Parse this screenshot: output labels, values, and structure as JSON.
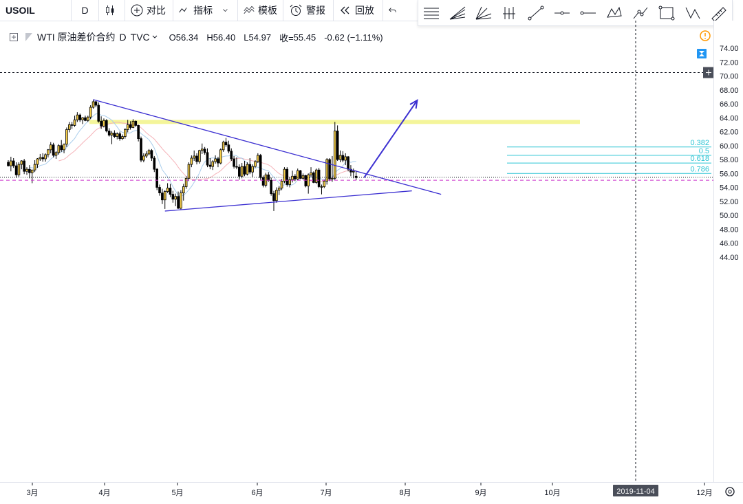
{
  "toolbar": {
    "symbol": "USOIL",
    "interval": "D",
    "compare_label": "对比",
    "indicators_label": "指标",
    "templates_label": "模板",
    "alert_label": "警报",
    "replay_label": "回放"
  },
  "legend": {
    "title": "WTI 原油差价合约",
    "interval": "D",
    "exchange": "TVC",
    "open_label": "O",
    "open": "56.34",
    "high_label": "H",
    "high": "56.40",
    "low_label": "L",
    "low": "54.97",
    "close_label": "收=",
    "close": "55.45",
    "change": "-0.62 (−1.11%)"
  },
  "drawing_tools": [
    "horizontal-lines-icon",
    "fan-lines-icon",
    "gann-fan-icon",
    "pitchfork-icon",
    "trend-line-icon",
    "horizontal-line-icon",
    "horizontal-ray-icon",
    "xabcd-pattern-icon",
    "path-icon",
    "rectangle-icon",
    "abcd-pattern-icon",
    "ruler-icon"
  ],
  "colors": {
    "up_fill": "#f7cf48",
    "down_fill": "#000000",
    "trendline": "#3b2fd1",
    "arrow": "#3b2fd1",
    "fib": "#2ac4d4",
    "support_band": "#f4f59a",
    "ma_slow": "#f5b2b8",
    "ma_fast": "#a9cdec",
    "price_badge": "#131722",
    "magenta_line": "#cc33cc",
    "crosshair_badge": "#4a4e59"
  },
  "chart_data": {
    "type": "candlestick",
    "symbol": "USOIL",
    "interval": "D",
    "y_axis": {
      "range": [
        42.5,
        75.5
      ],
      "ticks": [
        "74.00",
        "72.00",
        "70.00",
        "68.00",
        "66.00",
        "64.00",
        "62.00",
        "60.00",
        "58.00",
        "56.00",
        "54.00",
        "52.00",
        "50.00",
        "48.00",
        "46.00",
        "44.00"
      ]
    },
    "x_axis": {
      "ticks": [
        "3月",
        "4月",
        "5月",
        "6月",
        "7月",
        "8月",
        "9月",
        "10月",
        "12月"
      ],
      "crosshair_label": "2019-11-04"
    },
    "last_price": "55.45",
    "crosshair_price": "70.49",
    "magenta_price": "55.03",
    "support_band_level": 63.4,
    "fibonacci": [
      {
        "ratio": "0.382",
        "price": 59.8
      },
      {
        "ratio": "0.5",
        "price": 58.6
      },
      {
        "ratio": "0.618",
        "price": 57.5
      },
      {
        "ratio": "0.786",
        "price": 56.0
      }
    ],
    "candles": [
      [
        57.6,
        57.9,
        57.0,
        57.1
      ],
      [
        57.1,
        58.4,
        56.3,
        57.8
      ],
      [
        57.8,
        58.2,
        56.8,
        57.1
      ],
      [
        57.1,
        57.6,
        55.4,
        55.8
      ],
      [
        55.8,
        57.6,
        55.5,
        57.3
      ],
      [
        57.3,
        57.9,
        56.6,
        57.8
      ],
      [
        57.8,
        58.1,
        55.9,
        56.3
      ],
      [
        56.3,
        56.9,
        55.8,
        56.6
      ],
      [
        56.6,
        57.2,
        55.3,
        56.1
      ],
      [
        56.1,
        56.5,
        54.6,
        56.5
      ],
      [
        56.5,
        57.9,
        56.2,
        57.3
      ],
      [
        57.3,
        58.2,
        56.8,
        58.1
      ],
      [
        58.1,
        58.8,
        57.8,
        58.3
      ],
      [
        58.3,
        58.9,
        57.7,
        58.1
      ],
      [
        58.1,
        58.9,
        57.7,
        58.7
      ],
      [
        58.7,
        59.5,
        58.3,
        59.4
      ],
      [
        59.4,
        60.5,
        58.9,
        60.1
      ],
      [
        60.1,
        60.4,
        58.3,
        58.6
      ],
      [
        58.6,
        59.2,
        58.1,
        59.0
      ],
      [
        59.0,
        60.2,
        58.7,
        60.0
      ],
      [
        60.0,
        60.8,
        59.1,
        59.4
      ],
      [
        59.4,
        60.3,
        58.9,
        60.2
      ],
      [
        60.2,
        62.6,
        59.8,
        62.3
      ],
      [
        62.3,
        63.4,
        61.9,
        63.0
      ],
      [
        63.0,
        63.4,
        62.4,
        62.9
      ],
      [
        62.9,
        64.3,
        62.7,
        63.7
      ],
      [
        63.7,
        64.8,
        63.4,
        64.4
      ],
      [
        64.4,
        64.6,
        63.4,
        63.7
      ],
      [
        63.7,
        64.1,
        63.1,
        64.0
      ],
      [
        64.0,
        64.3,
        63.5,
        63.6
      ],
      [
        63.6,
        64.3,
        63.4,
        64.1
      ],
      [
        64.1,
        65.8,
        63.8,
        65.5
      ],
      [
        65.5,
        66.6,
        65.3,
        66.3
      ],
      [
        66.3,
        66.4,
        65.5,
        65.8
      ],
      [
        65.8,
        66.2,
        63.3,
        63.5
      ],
      [
        63.5,
        64.2,
        62.4,
        62.8
      ],
      [
        62.8,
        63.9,
        62.6,
        63.6
      ],
      [
        63.6,
        63.8,
        61.9,
        62.1
      ],
      [
        62.1,
        62.5,
        61.3,
        61.5
      ],
      [
        61.5,
        62.1,
        60.2,
        61.8
      ],
      [
        61.8,
        62.2,
        61.1,
        61.3
      ],
      [
        61.3,
        61.9,
        60.9,
        61.7
      ],
      [
        61.7,
        62.0,
        60.7,
        61.0
      ],
      [
        61.0,
        61.6,
        60.8,
        61.3
      ],
      [
        61.3,
        62.5,
        61.0,
        62.3
      ],
      [
        62.3,
        63.7,
        61.9,
        63.0
      ],
      [
        63.0,
        63.5,
        62.3,
        62.6
      ],
      [
        62.6,
        63.8,
        62.5,
        63.5
      ],
      [
        63.5,
        63.6,
        62.7,
        62.9
      ],
      [
        62.9,
        63.0,
        60.6,
        61.0
      ],
      [
        61.0,
        61.3,
        57.6,
        57.9
      ],
      [
        57.9,
        58.9,
        57.6,
        58.5
      ],
      [
        58.5,
        59.2,
        58.2,
        58.8
      ],
      [
        58.8,
        59.5,
        58.6,
        59.3
      ],
      [
        59.3,
        59.5,
        57.8,
        58.2
      ],
      [
        58.2,
        58.5,
        56.2,
        56.6
      ],
      [
        56.6,
        56.8,
        53.6,
        54.0
      ],
      [
        54.0,
        54.4,
        52.8,
        53.2
      ],
      [
        53.2,
        53.8,
        51.6,
        52.2
      ],
      [
        52.2,
        53.6,
        50.9,
        53.4
      ],
      [
        53.4,
        54.6,
        53.2,
        53.9
      ],
      [
        53.9,
        54.5,
        52.6,
        53.0
      ],
      [
        53.0,
        53.5,
        51.8,
        52.3
      ],
      [
        52.3,
        53.1,
        51.3,
        52.7
      ],
      [
        52.7,
        53.4,
        50.9,
        51.0
      ],
      [
        51.0,
        53.6,
        50.8,
        53.2
      ],
      [
        53.2,
        54.5,
        52.1,
        54.1
      ],
      [
        54.1,
        55.6,
        53.8,
        55.3
      ],
      [
        55.3,
        57.6,
        54.9,
        57.3
      ],
      [
        57.3,
        58.6,
        56.9,
        58.2
      ],
      [
        58.2,
        59.3,
        57.8,
        58.5
      ],
      [
        58.5,
        58.9,
        57.3,
        57.7
      ],
      [
        57.7,
        59.4,
        57.4,
        59.3
      ],
      [
        59.3,
        60.3,
        58.8,
        59.5
      ],
      [
        59.5,
        59.8,
        58.7,
        59.0
      ],
      [
        59.0,
        59.6,
        56.9,
        57.2
      ],
      [
        57.2,
        58.2,
        56.6,
        57.0
      ],
      [
        57.0,
        57.9,
        56.5,
        57.7
      ],
      [
        57.7,
        58.6,
        57.4,
        58.1
      ],
      [
        58.1,
        58.4,
        56.9,
        57.5
      ],
      [
        57.5,
        59.6,
        57.3,
        59.4
      ],
      [
        59.4,
        60.7,
        59.1,
        60.5
      ],
      [
        60.5,
        61.1,
        59.8,
        60.1
      ],
      [
        60.1,
        60.7,
        58.9,
        59.2
      ],
      [
        59.2,
        59.6,
        57.8,
        58.1
      ],
      [
        58.1,
        58.5,
        56.7,
        57.0
      ],
      [
        57.0,
        58.3,
        56.6,
        56.9
      ],
      [
        56.9,
        57.3,
        55.1,
        55.6
      ],
      [
        55.6,
        57.5,
        55.3,
        57.0
      ],
      [
        57.0,
        57.8,
        55.6,
        55.9
      ],
      [
        55.9,
        57.6,
        55.7,
        57.3
      ],
      [
        57.3,
        58.2,
        55.9,
        56.2
      ],
      [
        56.2,
        57.3,
        55.5,
        57.0
      ],
      [
        57.0,
        57.9,
        56.8,
        57.7
      ],
      [
        57.7,
        58.9,
        57.5,
        58.6
      ],
      [
        58.6,
        58.8,
        55.1,
        55.4
      ],
      [
        55.4,
        55.7,
        54.0,
        54.3
      ],
      [
        54.3,
        56.1,
        54.0,
        55.8
      ],
      [
        55.8,
        56.2,
        54.8,
        55.0
      ],
      [
        55.0,
        55.4,
        52.8,
        53.1
      ],
      [
        53.1,
        53.5,
        50.6,
        52.1
      ],
      [
        52.1,
        54.0,
        51.8,
        53.6
      ],
      [
        53.6,
        54.2,
        52.9,
        53.9
      ],
      [
        53.9,
        55.2,
        53.6,
        54.9
      ],
      [
        54.9,
        56.9,
        54.6,
        56.6
      ],
      [
        56.6,
        56.9,
        54.1,
        54.4
      ],
      [
        54.4,
        55.4,
        54.0,
        55.1
      ],
      [
        55.1,
        56.4,
        54.7,
        55.6
      ],
      [
        55.6,
        55.9,
        54.9,
        55.2
      ],
      [
        55.2,
        56.7,
        55.0,
        56.4
      ],
      [
        56.4,
        56.5,
        55.2,
        55.3
      ],
      [
        55.3,
        56.0,
        55.1,
        55.7
      ],
      [
        55.7,
        55.8,
        54.0,
        54.2
      ],
      [
        54.2,
        56.0,
        53.1,
        55.8
      ],
      [
        55.8,
        56.9,
        55.5,
        56.1
      ],
      [
        56.1,
        56.3,
        54.6,
        54.7
      ],
      [
        54.7,
        56.7,
        54.5,
        56.5
      ],
      [
        56.5,
        56.8,
        53.9,
        54.1
      ],
      [
        54.1,
        54.4,
        53.0,
        54.1
      ],
      [
        54.1,
        55.1,
        53.9,
        54.9
      ],
      [
        54.9,
        58.2,
        54.4,
        58.0
      ],
      [
        58.0,
        58.2,
        54.9,
        55.2
      ],
      [
        55.2,
        58.5,
        54.8,
        55.3
      ],
      [
        55.3,
        63.4,
        55.0,
        62.1
      ],
      [
        62.1,
        62.9,
        57.8,
        58.0
      ],
      [
        58.0,
        59.3,
        57.6,
        58.6
      ],
      [
        58.6,
        59.2,
        57.6,
        57.9
      ],
      [
        57.9,
        58.9,
        57.2,
        58.4
      ],
      [
        58.4,
        58.5,
        56.3,
        56.6
      ],
      [
        56.6,
        57.2,
        55.6,
        56.2
      ],
      [
        56.2,
        56.7,
        55.3,
        56.3
      ],
      [
        55.6,
        56.4,
        55.0,
        55.4
      ]
    ],
    "annotations": {
      "triangle_upper": {
        "from": {
          "index": 32,
          "price": 66.6
        },
        "to": {
          "index": 163,
          "price": 53.0
        }
      },
      "triangle_lower": {
        "from": {
          "index": 59,
          "price": 50.6
        },
        "to": {
          "index": 152,
          "price": 53.5
        }
      },
      "forecast_arrow": {
        "from": {
          "index": 134,
          "price": 55.4
        },
        "to": {
          "index": 154,
          "price": 66.5
        }
      }
    }
  }
}
